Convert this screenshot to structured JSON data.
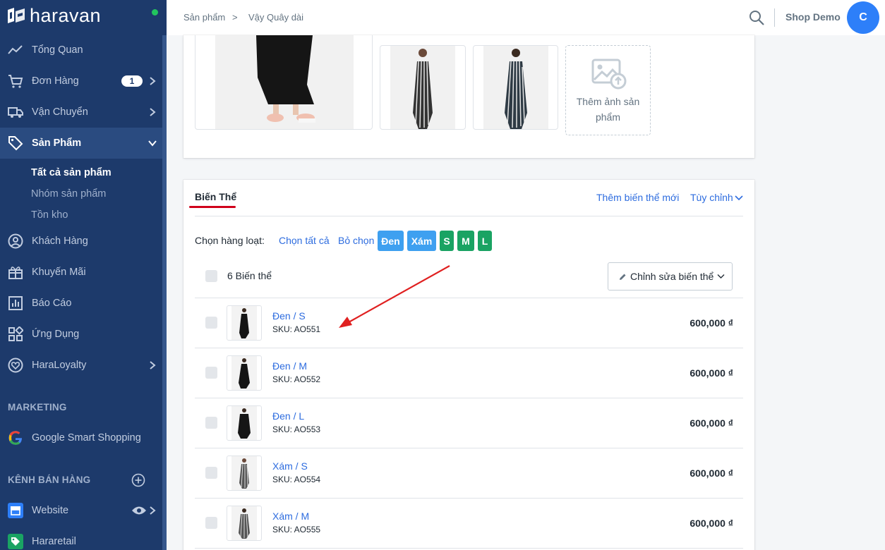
{
  "brand": {
    "name": "haravan"
  },
  "sidebar": {
    "items": [
      {
        "label": "Tổng Quan"
      },
      {
        "label": "Đơn Hàng",
        "badge": "1"
      },
      {
        "label": "Vận Chuyển"
      },
      {
        "label": "Sản Phẩm"
      },
      {
        "label": "Khách Hàng"
      },
      {
        "label": "Khuyến Mãi"
      },
      {
        "label": "Báo Cáo"
      },
      {
        "label": "Ứng Dụng"
      },
      {
        "label": "HaraLoyalty"
      }
    ],
    "subitems": [
      {
        "label": "Tất cả sản phẩm"
      },
      {
        "label": "Nhóm sản phẩm"
      },
      {
        "label": "Tồn kho"
      }
    ],
    "marketing_title": "MARKETING",
    "marketing_items": [
      {
        "label": "Google Smart Shopping"
      }
    ],
    "channels_title": "KÊNH BÁN HÀNG",
    "channel_items": [
      {
        "label": "Website"
      },
      {
        "label": "Hararetail"
      }
    ]
  },
  "header": {
    "breadcrumb": [
      "Sản phẩm",
      "Vậy Quây dài"
    ],
    "breadcrumb_sep": ">",
    "shop_name": "Shop Demo",
    "avatar_initial": "C"
  },
  "media": {
    "add_image_label_line1": "Thêm ảnh sản",
    "add_image_label_line2": "phẩm"
  },
  "variants": {
    "tab_title": "Biến Thể",
    "add_variant": "Thêm biến thể mới",
    "customize": "Tùy chỉnh",
    "bulk_label": "Chọn hàng loạt:",
    "select_all": "Chọn tất cả",
    "deselect": "Bỏ chọn",
    "chips": [
      "Đen",
      "Xám",
      "S",
      "M",
      "L"
    ],
    "count_label": "6 Biến thể",
    "edit_button": "Chỉnh sửa biến thể",
    "rows": [
      {
        "name": "Đen / S",
        "sku": "SKU: AO551",
        "price": "600,000 ₫"
      },
      {
        "name": "Đen / M",
        "sku": "SKU: AO552",
        "price": "600,000 ₫"
      },
      {
        "name": "Đen / L",
        "sku": "SKU: AO553",
        "price": "600,000 ₫"
      },
      {
        "name": "Xám / S",
        "sku": "SKU: AO554",
        "price": "600,000 ₫"
      },
      {
        "name": "Xám / M",
        "sku": "SKU: AO555",
        "price": "600,000 ₫"
      }
    ]
  },
  "colors": {
    "sidebar_bg": "#1d3a6b",
    "accent_blue": "#2d6cdf",
    "chip_blue": "#3ea0f0",
    "chip_green": "#1aa363",
    "annotation_red": "#e02020"
  }
}
